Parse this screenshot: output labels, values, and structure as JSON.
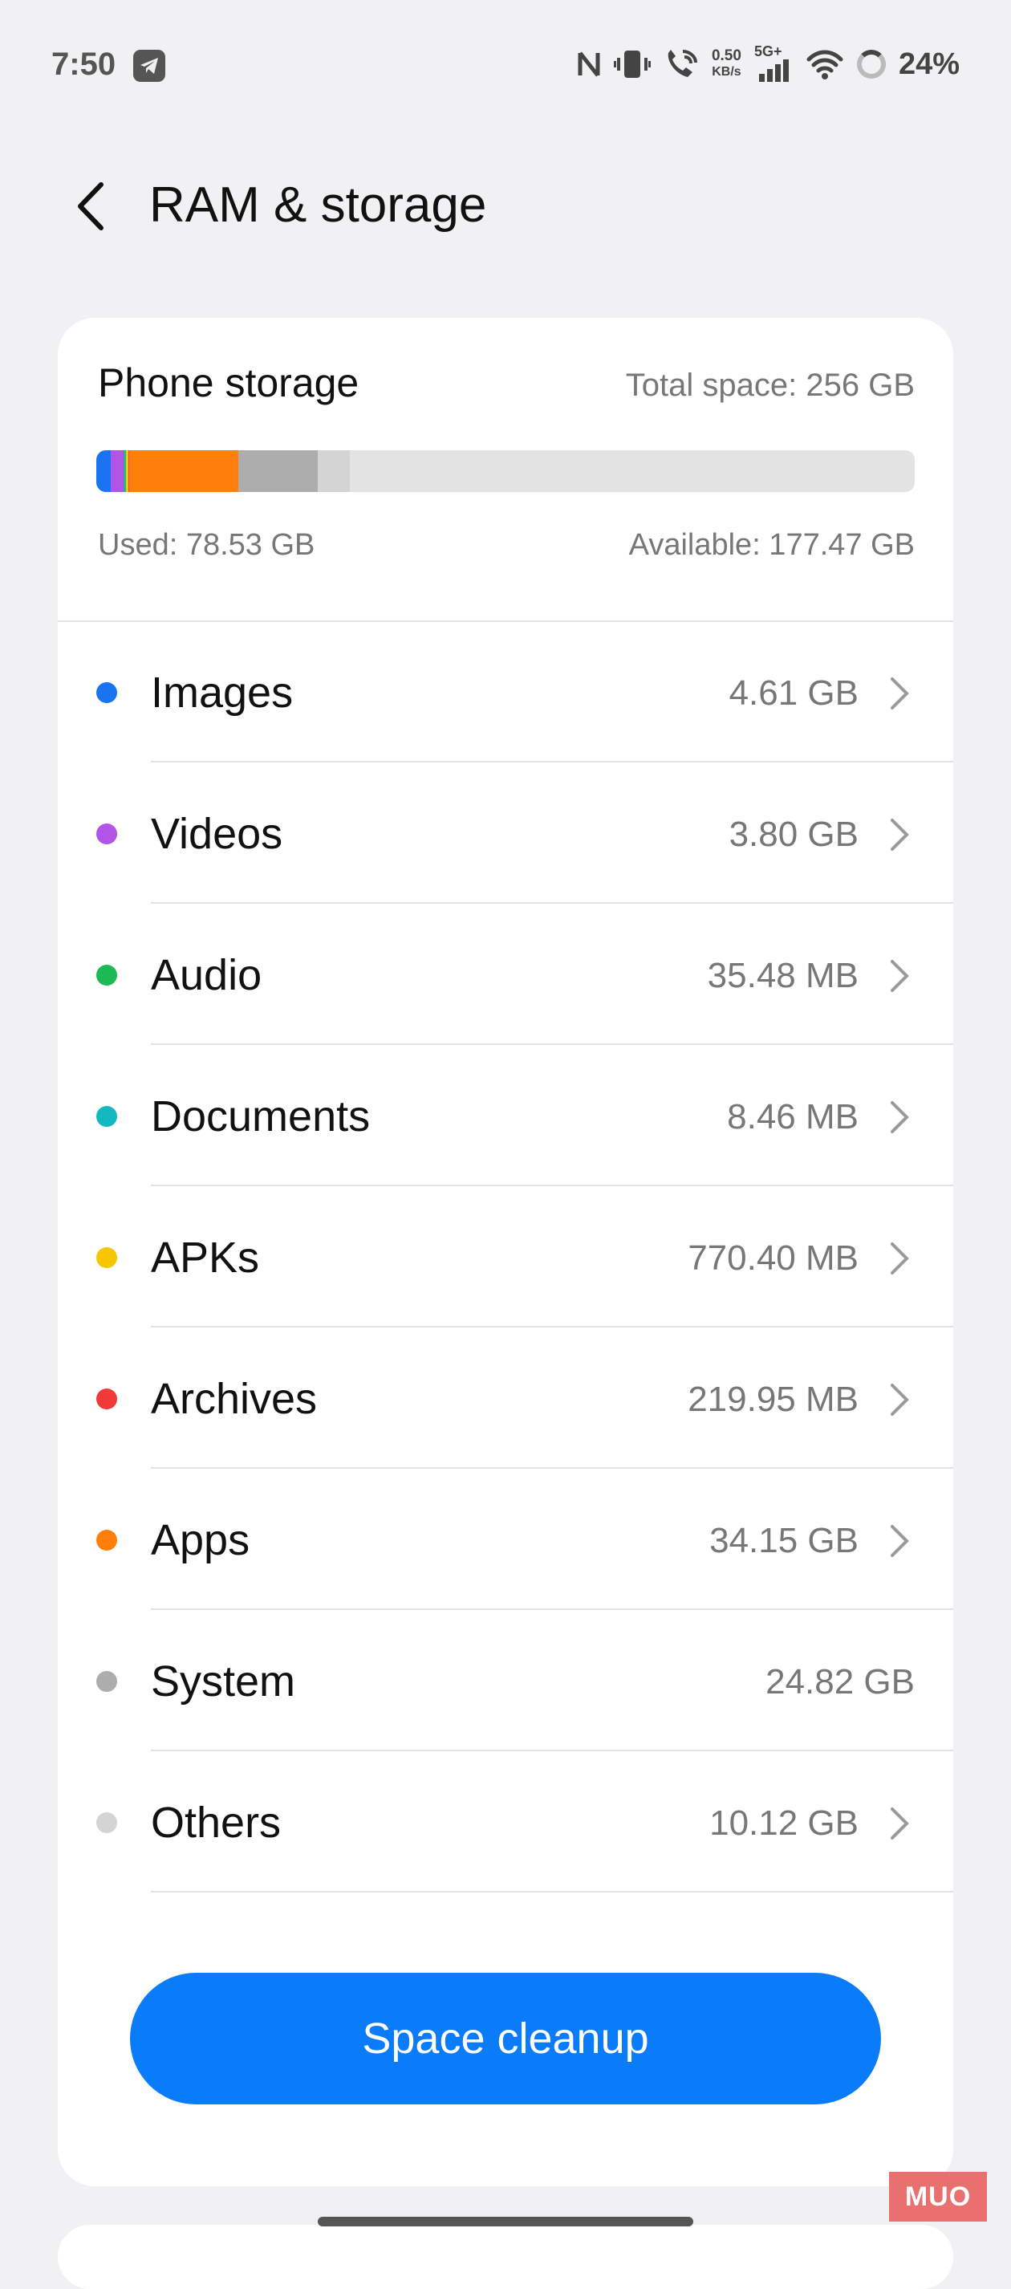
{
  "status_bar": {
    "time": "7:50",
    "net_speed_value": "0.50",
    "net_speed_unit": "KB/s",
    "network": "5G+",
    "battery": "24%"
  },
  "header": {
    "title": "RAM & storage"
  },
  "storage": {
    "title": "Phone storage",
    "total": "Total space: 256 GB",
    "used": "Used: 78.53 GB",
    "available": "Available: 177.47 GB",
    "usage_bar": [
      {
        "category": "Images",
        "gb": 4.61,
        "color": "#1a73f0"
      },
      {
        "category": "Videos",
        "gb": 3.8,
        "color": "#b254e6"
      },
      {
        "category": "Audio",
        "gb": 0.035,
        "color": "#1db954"
      },
      {
        "category": "Documents",
        "gb": 0.008,
        "color": "#14b8c0"
      },
      {
        "category": "APKs",
        "gb": 0.77,
        "color": "#f6c700"
      },
      {
        "category": "Archives",
        "gb": 0.22,
        "color": "#f03a3a"
      },
      {
        "category": "Apps",
        "gb": 34.15,
        "color": "#ff7f0a"
      },
      {
        "category": "System",
        "gb": 24.82,
        "color": "#adadad"
      },
      {
        "category": "Others",
        "gb": 10.12,
        "color": "#d4d4d4"
      }
    ],
    "total_gb": 256
  },
  "categories": [
    {
      "label": "Images",
      "value": "4.61 GB",
      "color": "#1a73f0",
      "chevron": true
    },
    {
      "label": "Videos",
      "value": "3.80 GB",
      "color": "#b254e6",
      "chevron": true
    },
    {
      "label": "Audio",
      "value": "35.48 MB",
      "color": "#1db954",
      "chevron": true
    },
    {
      "label": "Documents",
      "value": "8.46 MB",
      "color": "#14b8c0",
      "chevron": true
    },
    {
      "label": "APKs",
      "value": "770.40 MB",
      "color": "#f6c700",
      "chevron": true
    },
    {
      "label": "Archives",
      "value": "219.95 MB",
      "color": "#f03a3a",
      "chevron": true
    },
    {
      "label": "Apps",
      "value": "34.15 GB",
      "color": "#ff7f0a",
      "chevron": true
    },
    {
      "label": "System",
      "value": "24.82 GB",
      "color": "#adadad",
      "chevron": false
    },
    {
      "label": "Others",
      "value": "10.12 GB",
      "color": "#d4d4d4",
      "chevron": true
    }
  ],
  "actions": {
    "cleanup_label": "Space cleanup"
  },
  "watermark": "MUO"
}
